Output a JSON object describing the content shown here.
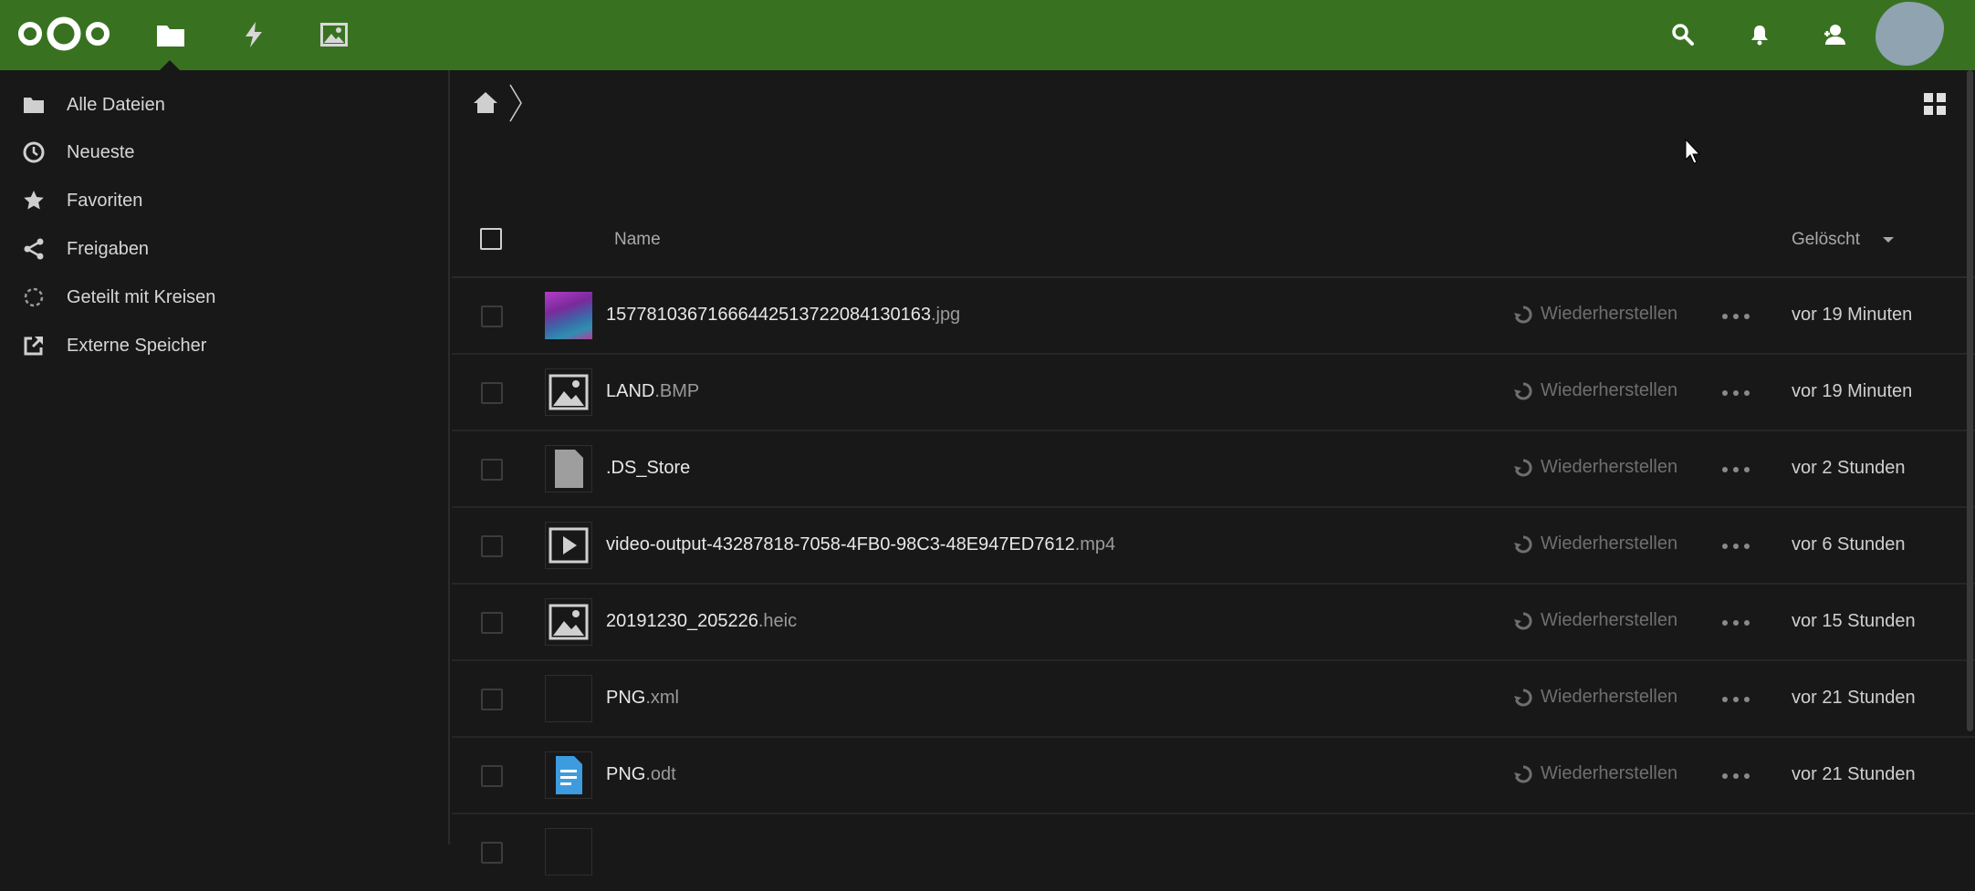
{
  "header": {
    "apps": [
      {
        "name": "files-app",
        "icon": "folder-icon"
      },
      {
        "name": "activity-app",
        "icon": "lightning-icon"
      },
      {
        "name": "gallery-app",
        "icon": "image-icon"
      }
    ],
    "right_icons": [
      "search-icon",
      "bell-icon",
      "contacts-icon"
    ],
    "brand_color": "#387221"
  },
  "sidebar": {
    "items": [
      {
        "label": "Alle Dateien",
        "icon": "folder-icon"
      },
      {
        "label": "Neueste",
        "icon": "clock-icon"
      },
      {
        "label": "Favoriten",
        "icon": "star-icon"
      },
      {
        "label": "Freigaben",
        "icon": "share-icon"
      },
      {
        "label": "Geteilt mit Kreisen",
        "icon": "circles-icon"
      },
      {
        "label": "Externe Speicher",
        "icon": "external-link-icon"
      }
    ]
  },
  "list": {
    "col_name": "Name",
    "col_deleted": "Gelöscht",
    "restore_label": "Wiederherstellen",
    "rows": [
      {
        "base": "15778103671666442513722084130163",
        "ext": ".jpg",
        "when": "vor 19 Minuten",
        "thumb": "photo"
      },
      {
        "base": "LAND",
        "ext": ".BMP",
        "when": "vor 19 Minuten",
        "thumb": "image-icon"
      },
      {
        "base": ".DS_Store",
        "ext": "",
        "when": "vor 2 Stunden",
        "thumb": "file-icon"
      },
      {
        "base": "video-output-43287818-7058-4FB0-98C3-48E947ED7612",
        "ext": ".mp4",
        "when": "vor 6 Stunden",
        "thumb": "video-icon"
      },
      {
        "base": "20191230_205226",
        "ext": ".heic",
        "when": "vor 15 Stunden",
        "thumb": "image-icon"
      },
      {
        "base": "PNG",
        "ext": ".xml",
        "when": "vor 21 Stunden",
        "thumb": "blank"
      },
      {
        "base": "PNG",
        "ext": ".odt",
        "when": "vor 21 Stunden",
        "thumb": "document-icon"
      }
    ]
  }
}
